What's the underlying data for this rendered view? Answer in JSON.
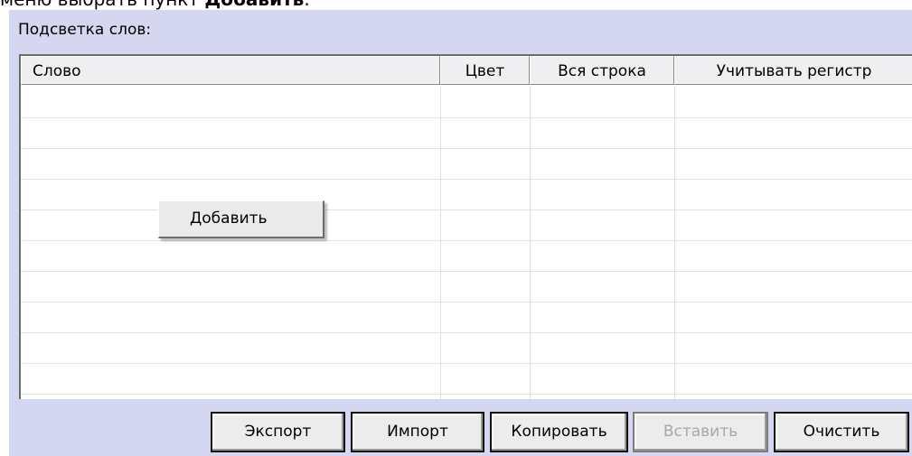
{
  "caption": {
    "text": "меню выбрать пункт ",
    "bold": "Добавить",
    "tail": "."
  },
  "section": {
    "label": "Подсветка слов:"
  },
  "table": {
    "columns": [
      "Слово",
      "Цвет",
      "Вся строка",
      "Учитывать регистр"
    ],
    "rows": []
  },
  "context_menu": {
    "items": [
      "Добавить"
    ]
  },
  "buttons": {
    "export": "Экспорт",
    "import": "Импорт",
    "copy": "Копировать",
    "paste": "Вставить",
    "clear": "Очистить"
  },
  "colors": {
    "panel_bg": "#d5d6f0",
    "disabled_text": "#a8a8a8"
  }
}
